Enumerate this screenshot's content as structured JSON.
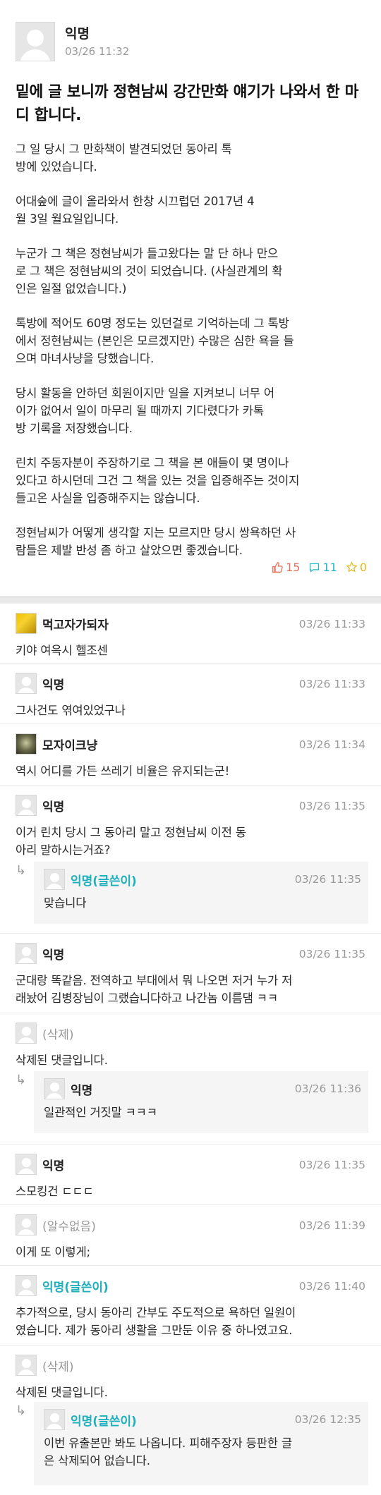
{
  "post": {
    "author": "익명",
    "time": "03/26 11:32",
    "title": "밑에 글 보니까 정현남씨 강간만화 얘기가 나와서 한 마디 합니다.",
    "paragraphs": [
      "그 일 당시 그 만화책이 발견되었던 동아리 톡\n방에 있었습니다.",
      "어대숲에 글이 올라와서 한창 시끄럽던 2017년 4\n월 3일 월요일입니다.",
      "누군가 그 책은 정현남씨가 들고왔다는 말 단 하나 만으\n로 그 책은 정현남씨의 것이 되었습니다. (사실관계의 확\n인은 일절 없었습니다.)",
      "톡방에 적어도 60명 정도는 있던걸로 기억하는데 그 톡방\n에서 정현남씨는 (본인은 모르겠지만) 수많은 심한 욕을 들\n으며 마녀사냥을 당했습니다.",
      "당시 활동을 안하던 회원이지만 일을 지켜보니 너무 어\n이가 없어서 일이 마무리 될 때까지 기다렸다가 카톡\n방 기록을 저장했습니다.",
      "린치 주동자분이 주장하기로 그 책을 본 애들이 몇 명이나\n있다고 하시던데 그건 그 책을 있는 것을 입증해주는 것이지\n들고온 사실을 입증해주지는 않습니다.",
      "정현남씨가 어떻게 생각할 지는 모르지만 당시 쌍욕하던 사\n람들은 제발 반성 좀 하고 살았으면 좋겠습니다."
    ],
    "votes": "15",
    "comments_count": "11",
    "scraps": "0"
  },
  "comments": [
    {
      "name": "먹고자가되자",
      "time": "03/26 11:33",
      "text": "키야 여윽시 헬조센"
    },
    {
      "name": "익명",
      "time": "03/26 11:33",
      "text": "그사건도 엮여있었구나"
    },
    {
      "name": "모자이크냥",
      "time": "03/26 11:34",
      "text": "역시 어디를 가든 쓰레기 비율은 유지되는군!"
    },
    {
      "name": "익명",
      "time": "03/26 11:35",
      "text": "이거 린치 당시 그 동아리 말고 정현남씨 이전 동\n아리 말하시는거죠?"
    },
    {
      "name": "익명(글쓴이)",
      "time": "03/26 11:35",
      "text": "맞습니다"
    },
    {
      "name": "익명",
      "time": "03/26 11:35",
      "text": "군대랑 똑같음. 전역하고 부대에서 뭐 나오면 저거 누가 저\n래놨어 김병장님이 그랬습니다하고 나간놈 이름댐 ㅋㅋ"
    },
    {
      "name": "(삭제)",
      "time": "",
      "text": "삭제된 댓글입니다."
    },
    {
      "name": "익명",
      "time": "03/26 11:36",
      "text": "일관적인 거짓말 ㅋㅋㅋ"
    },
    {
      "name": "익명",
      "time": "03/26 11:35",
      "text": "스모킹건 ㄷㄷㄷ"
    },
    {
      "name": "(알수없음)",
      "time": "03/26 11:39",
      "text": "이게 또 이렇게;"
    },
    {
      "name": "익명(글쓴이)",
      "time": "03/26 11:40",
      "text": "추가적으로, 당시 동아리 간부도 주도적으로 욕하던 일원이\n였습니다. 제가 동아리 생활을 그만둔 이유 중 하나였고요."
    },
    {
      "name": "(삭제)",
      "time": "",
      "text": "삭제된 댓글입니다."
    },
    {
      "name": "익명(글쓴이)",
      "time": "03/26 12:35",
      "text": "이번 유출본만 봐도 나옵니다. 피해주장자 등판한 글\n은 삭제되어 없습니다."
    }
  ],
  "reply_arrow": "↳",
  "colors": {
    "vote": "#e5705a",
    "comment": "#1fb7c3",
    "scrap": "#e2b819",
    "author_tag": "#1fb0bd"
  }
}
